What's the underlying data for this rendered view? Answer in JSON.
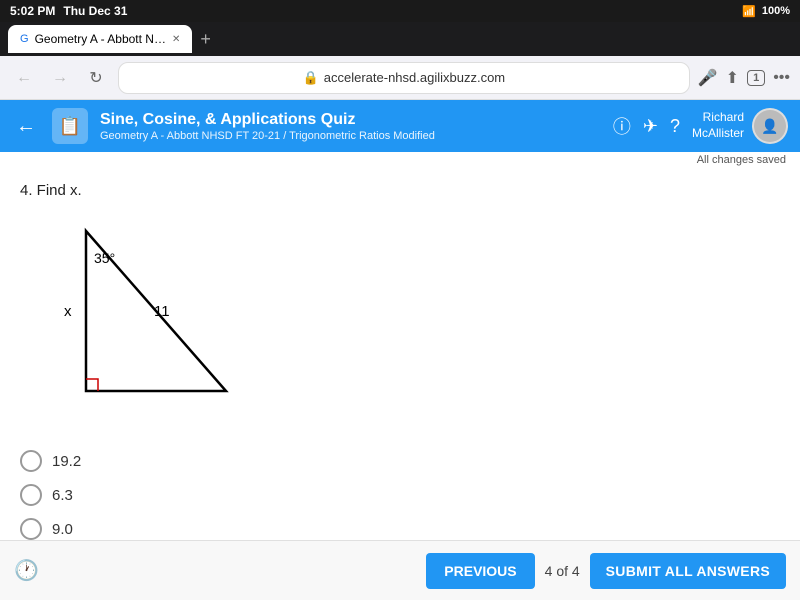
{
  "statusBar": {
    "time": "5:02 PM",
    "day": "Thu Dec 31",
    "wifi": "wifi",
    "battery": "100%"
  },
  "browserTab": {
    "label": "Geometry A - Abbott N…",
    "newTab": "+"
  },
  "addressBar": {
    "url": "accelerate-nhsd.agilixbuzz.com",
    "lockIcon": "🔒"
  },
  "appHeader": {
    "title": "Sine, Cosine, & Applications Quiz",
    "subtitle": "Geometry A - Abbott NHSD FT 20-21 / Trigonometric Ratios Modified",
    "userName": "Richard\nMcAllister",
    "savedText": "All changes saved"
  },
  "question": {
    "label": "4. Find x.",
    "triangle": {
      "angle": "35°",
      "hypotenuse": "11",
      "side": "x"
    },
    "choices": [
      {
        "id": "a",
        "value": "19.2"
      },
      {
        "id": "b",
        "value": "6.3"
      },
      {
        "id": "c",
        "value": "9.0"
      }
    ]
  },
  "bottomBar": {
    "previousLabel": "PREVIOUS",
    "pageIndicator": "4 of 4",
    "submitLabel": "SUBMIT ALL ANSWERS"
  }
}
